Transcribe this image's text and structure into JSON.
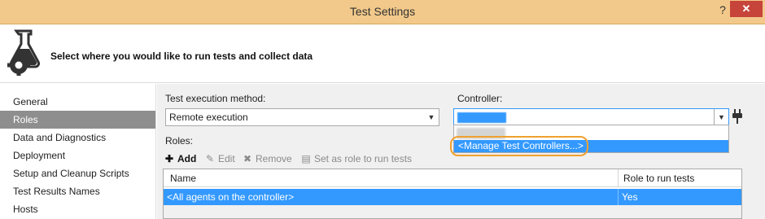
{
  "window": {
    "title": "Test Settings",
    "help_glyph": "?",
    "close_glyph": "✕"
  },
  "header": {
    "heading": "Select where you would like to run tests and collect data",
    "logo_icon": "flask-gear-icon"
  },
  "sidebar": {
    "items": [
      {
        "label": "General",
        "selected": false
      },
      {
        "label": "Roles",
        "selected": true
      },
      {
        "label": "Data and Diagnostics",
        "selected": false
      },
      {
        "label": "Deployment",
        "selected": false
      },
      {
        "label": "Setup and Cleanup Scripts",
        "selected": false
      },
      {
        "label": "Test Results Names",
        "selected": false
      },
      {
        "label": "Hosts",
        "selected": false
      }
    ]
  },
  "execution": {
    "label": "Test execution method:",
    "value": "Remote execution"
  },
  "controller": {
    "label": "Controller:",
    "dropdown_option": "<Manage Test Controllers...>"
  },
  "roles": {
    "label": "Roles:",
    "toolbar": {
      "add": "Add",
      "edit": "Edit",
      "remove": "Remove",
      "set_role": "Set as role to run tests"
    },
    "columns": [
      "Name",
      "Role to run tests"
    ],
    "rows": [
      {
        "name": "<All agents on the controller>",
        "role": "Yes"
      }
    ]
  },
  "colors": {
    "titlebar": "#f2c98a",
    "close": "#c7443a",
    "selection": "#3399ff",
    "sidebar_selected": "#8e8e8e",
    "highlight_ring": "#f0a030"
  }
}
